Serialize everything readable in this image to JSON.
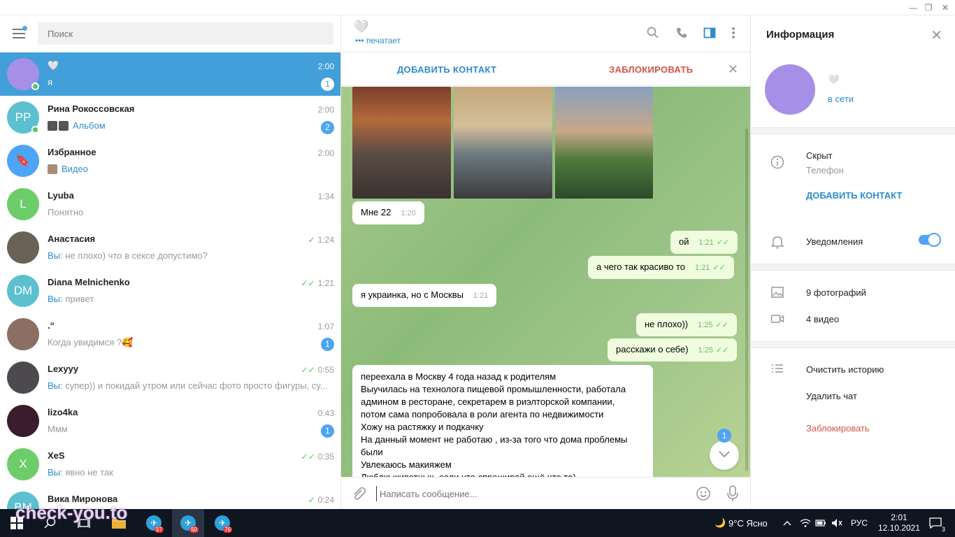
{
  "window": {
    "minimize": "—",
    "restore": "❐",
    "close": "✕"
  },
  "search": {
    "placeholder": "Поиск"
  },
  "chats": [
    {
      "name": "🤍",
      "preview": "я",
      "time": "2:00",
      "badge": "1",
      "avatar_color": "#a68fe6",
      "initials": ""
    },
    {
      "name": "Рина Рокоссовская",
      "preview": "Альбом",
      "time": "2:00",
      "badge": "2",
      "avatar_color": "#5cc0cf",
      "initials": "РР"
    },
    {
      "name": "Избранное",
      "preview": "Видео",
      "time": "2:00",
      "avatar_color": "#4ea4f6",
      "initials": "🔖"
    },
    {
      "name": "Lyuba",
      "preview": "Понятно",
      "time": "1:34",
      "avatar_color": "#6dcd6a",
      "initials": "L"
    },
    {
      "name": "Анастасия",
      "you": "Вы:",
      "preview": "не плохо) что в сексе допустимо?",
      "time": "1:24",
      "avatar_color": "#6b6257",
      "initials": ""
    },
    {
      "name": "Diana Melnichenko",
      "you": "Вы:",
      "preview": "привет",
      "time": "1:21",
      "avatar_color": "#5cc0cf",
      "initials": "DM"
    },
    {
      "name": ".“",
      "preview": "Когда увидимся ?🥰",
      "time": "1:07",
      "badge": "1",
      "avatar_color": "#8a6f62",
      "initials": ""
    },
    {
      "name": "Lexyyy",
      "you": "Вы:",
      "preview": "супер)) и покидай утром или сейчас фото просто фигуры, су...",
      "time": "0:55",
      "avatar_color": "#4d4a4f",
      "initials": ""
    },
    {
      "name": "lizo4ka",
      "preview": "Ммм",
      "time": "0:43",
      "badge": "1",
      "avatar_color": "#3a1c2c",
      "initials": ""
    },
    {
      "name": "XeS",
      "you": "Вы:",
      "preview": "явно не так",
      "time": "0:35",
      "avatar_color": "#6dcd6a",
      "initials": "X"
    },
    {
      "name": "Вика Миронова",
      "preview": "",
      "time": "0:24",
      "avatar_color": "#5cc0cf",
      "initials": "ВМ"
    }
  ],
  "header": {
    "name": "🤍",
    "status": "печатает"
  },
  "actions": {
    "add_contact": "ДОБАВИТЬ КОНТАКТ",
    "block": "ЗАБЛОКИРОВАТЬ"
  },
  "messages": [
    {
      "text": "Мне 22",
      "time": "1:20",
      "out": false
    },
    {
      "text": "ой",
      "time": "1:21",
      "out": true
    },
    {
      "text": "а чего так красиво то",
      "time": "1:21",
      "out": true
    },
    {
      "text": "я украинка, но с Москвы",
      "time": "1:21",
      "out": false
    },
    {
      "text": "не плохо))",
      "time": "1:25",
      "out": true
    },
    {
      "text": "расскажи о себе)",
      "time": "1:25",
      "out": true
    }
  ],
  "long_message": [
    "переехала в Москву 4 года назад к родителям",
    "Выучилась на технолога пищевой промышленности, работала",
    "админом в ресторане, секретарем в риэлторской компании,",
    "потом сама попробовала в роли агента по недвижимости",
    "Хожу на растяжку и подкачку",
    "На данный момент не работаю , из-за того что дома проблемы",
    "были",
    "Увлекаюсь макияжем",
    "Люблю животных, если что спрашивай ещё что то)"
  ],
  "scroll_badge": "1",
  "composer": {
    "placeholder": "Написать сообщение..."
  },
  "info": {
    "title": "Информация",
    "name": "🤍",
    "status": "в сети",
    "phone_value": "Скрыт",
    "phone_label": "Телефон",
    "add_contact": "ДОБАВИТЬ КОНТАКТ",
    "notifications": "Уведомления",
    "photos": "9 фотографий",
    "videos": "4 видео",
    "clear_history": "Очистить историю",
    "delete_chat": "Удалить чат",
    "block": "Заблокировать"
  },
  "taskbar": {
    "weather": "9°C  Ясно",
    "lang": "РУС",
    "time": "2:01",
    "date": "12.10.2021",
    "notif": "3",
    "tg1_badge": "57",
    "tg2_badge": "50",
    "tg3_badge": "76",
    "watermark": "check-you.to"
  },
  "colors": {
    "accent": "#419fd9",
    "danger": "#d5534b",
    "online": "#4bcb5a"
  }
}
